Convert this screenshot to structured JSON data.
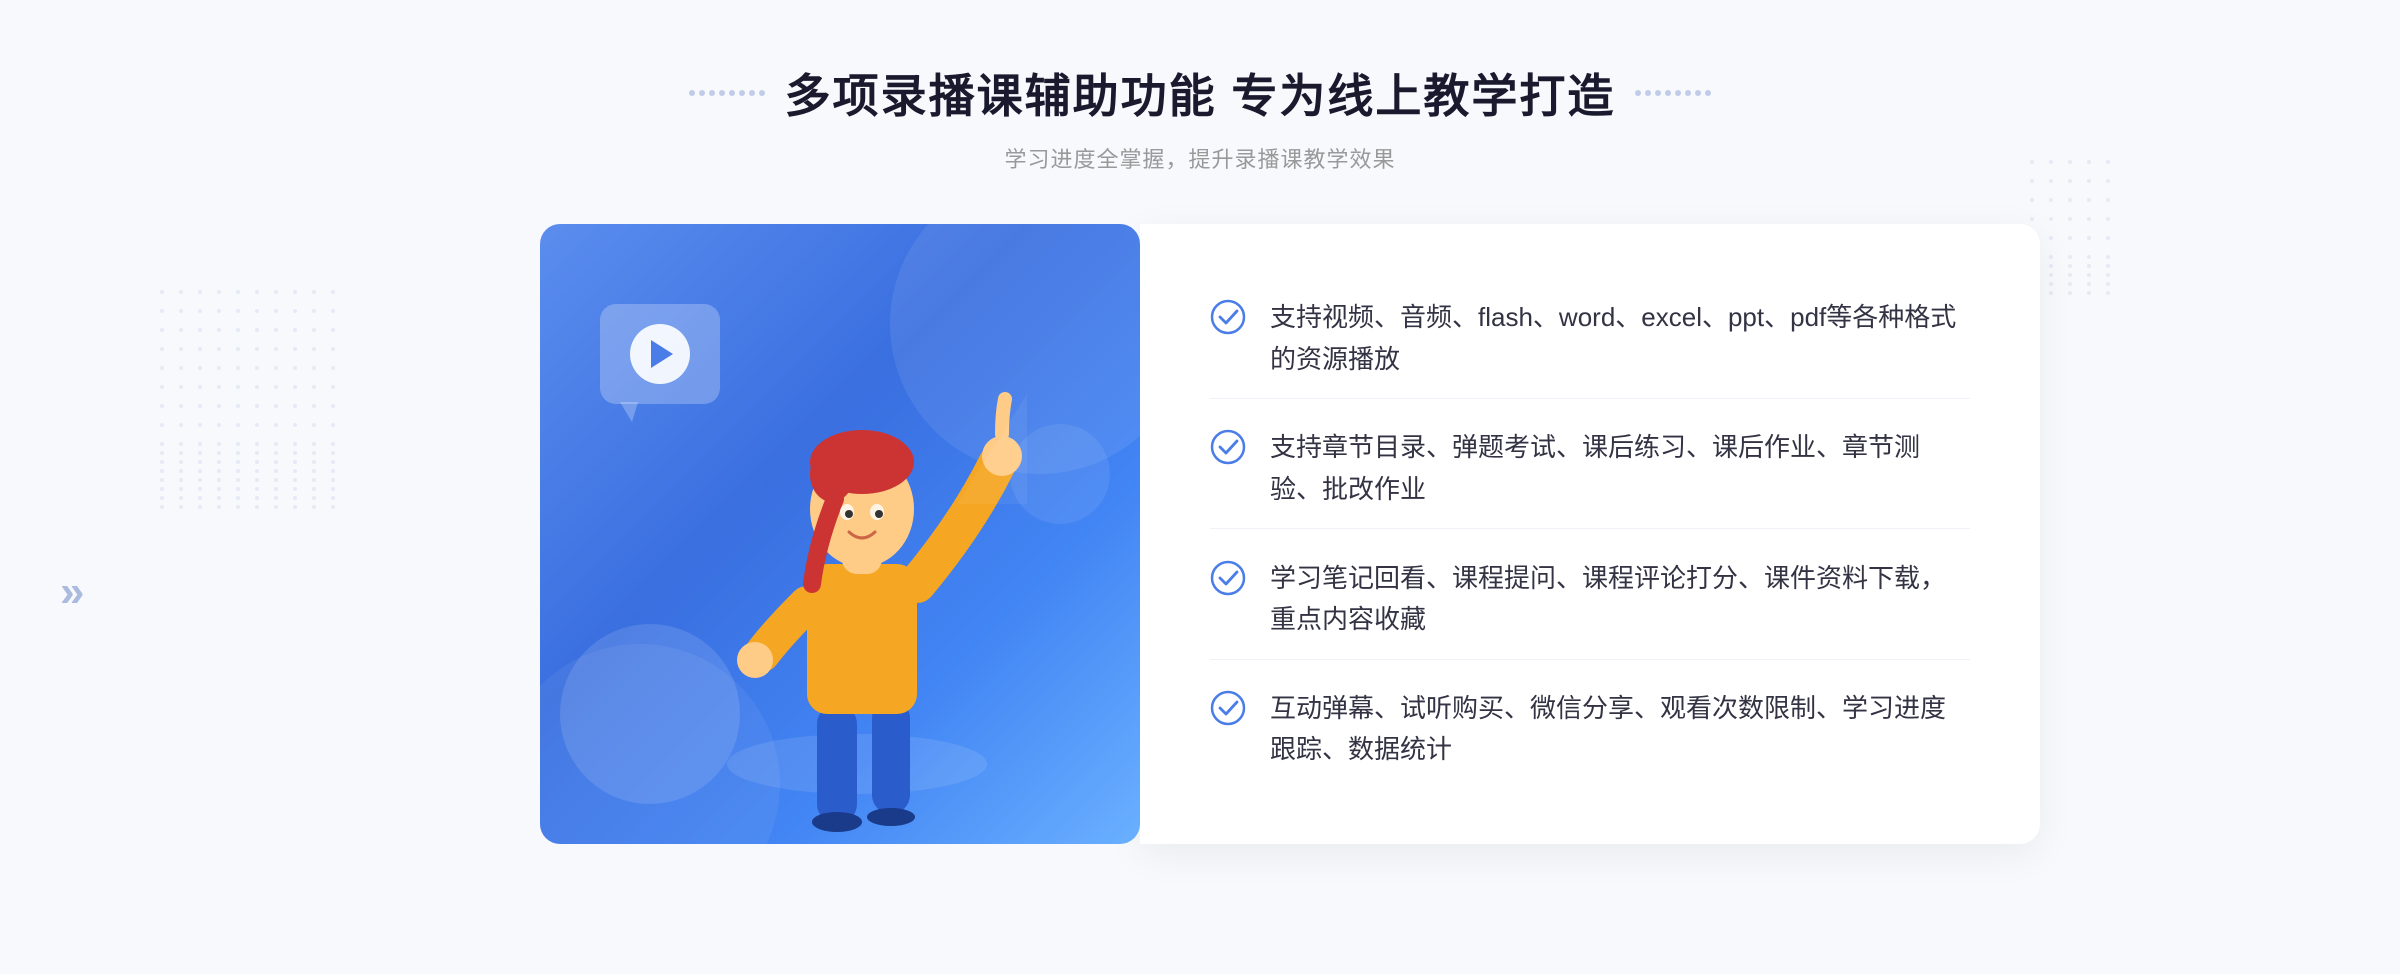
{
  "header": {
    "title": "多项录播课辅助功能 专为线上教学打造",
    "subtitle": "学习进度全掌握，提升录播课教学效果"
  },
  "features": [
    {
      "id": "feature-1",
      "text": "支持视频、音频、flash、word、excel、ppt、pdf等各种格式的资源播放"
    },
    {
      "id": "feature-2",
      "text": "支持章节目录、弹题考试、课后练习、课后作业、章节测验、批改作业"
    },
    {
      "id": "feature-3",
      "text": "学习笔记回看、课程提问、课程评论打分、课件资料下载，重点内容收藏"
    },
    {
      "id": "feature-4",
      "text": "互动弹幕、试听购买、微信分享、观看次数限制、学习进度跟踪、数据统计"
    }
  ],
  "colors": {
    "accent_blue": "#4a7de8",
    "check_color": "#4a7de8",
    "text_primary": "#333344",
    "text_secondary": "#999999"
  }
}
